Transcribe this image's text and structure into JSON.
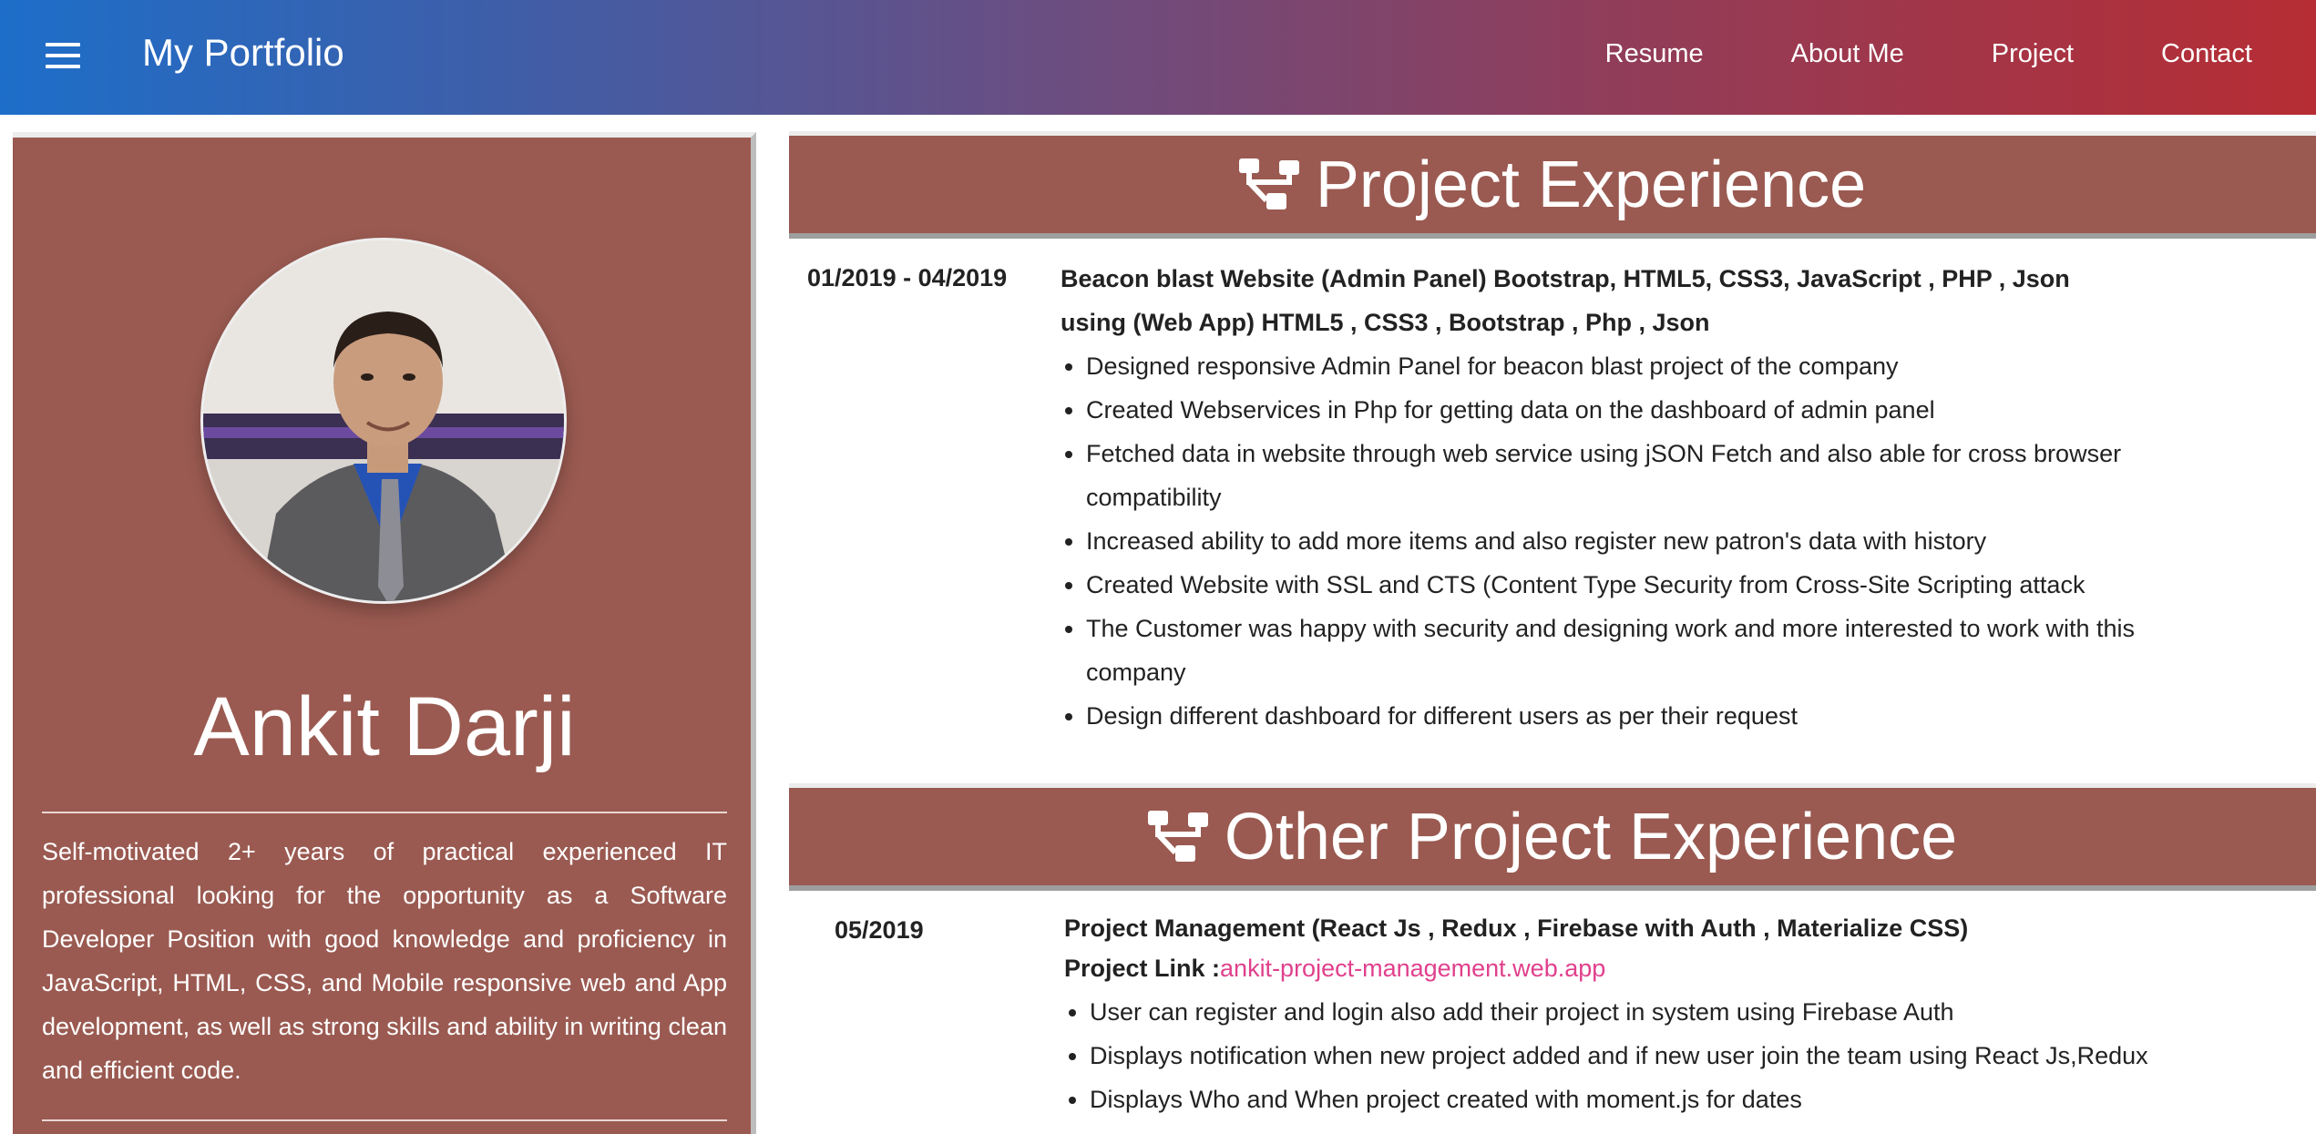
{
  "header": {
    "menu_icon": "hamburger-menu-icon",
    "brand": "My Portfolio",
    "nav": [
      "Resume",
      "About Me",
      "Project",
      "Contact"
    ]
  },
  "profile": {
    "name": "Ankit Darji",
    "about": "Self-motivated 2+ years of practical experienced IT professional looking for the opportunity as a Software Developer Position with good knowledge and proficiency in JavaScript, HTML, CSS, and Mobile responsive web and App development, as well as strong skills and ability in writing clean and efficient code."
  },
  "sections": {
    "project": {
      "title": "Project Experience",
      "icon": "sitemap-icon",
      "date": "01/2019 - 04/2019",
      "title_line1": "Beacon blast Website (Admin Panel) Bootstrap, HTML5, CSS3, JavaScript , PHP , Json",
      "title_line2": "using (Web App) HTML5 , CSS3 , Bootstrap , Php , Json",
      "bullets": [
        "Designed responsive Admin Panel for beacon blast project of the company",
        "Created Webservices in Php for getting data on the dashboard of admin panel",
        "Fetched data in website through web service using jSON Fetch and also able for cross browser compatibility",
        "Increased ability to add more items and also register new patron's data with history",
        "Created Website with SSL and CTS (Content Type Security from Cross-Site Scripting attack",
        "The Customer was happy with security and designing work and more interested to work with this company",
        "Design different dashboard for different users as per their request"
      ]
    },
    "other": {
      "title": "Other Project Experience",
      "icon": "sitemap-icon",
      "date": "05/2019",
      "title_line1": "Project Management (React Js , Redux , Firebase with Auth , Materialize CSS)",
      "link_label": "Project Link :",
      "link_text": "ankit-project-management.web.app",
      "bullets": [
        "User can register and login also add their project in system using Firebase Auth",
        "Displays notification when new project added and if new user join the team using React Js,Redux",
        "Displays Who and When project created with moment.js for dates"
      ]
    }
  },
  "colors": {
    "card": "#9a5a51",
    "link": "#e0408c",
    "header_start": "#1d6ec9",
    "header_end": "#b62d34"
  }
}
